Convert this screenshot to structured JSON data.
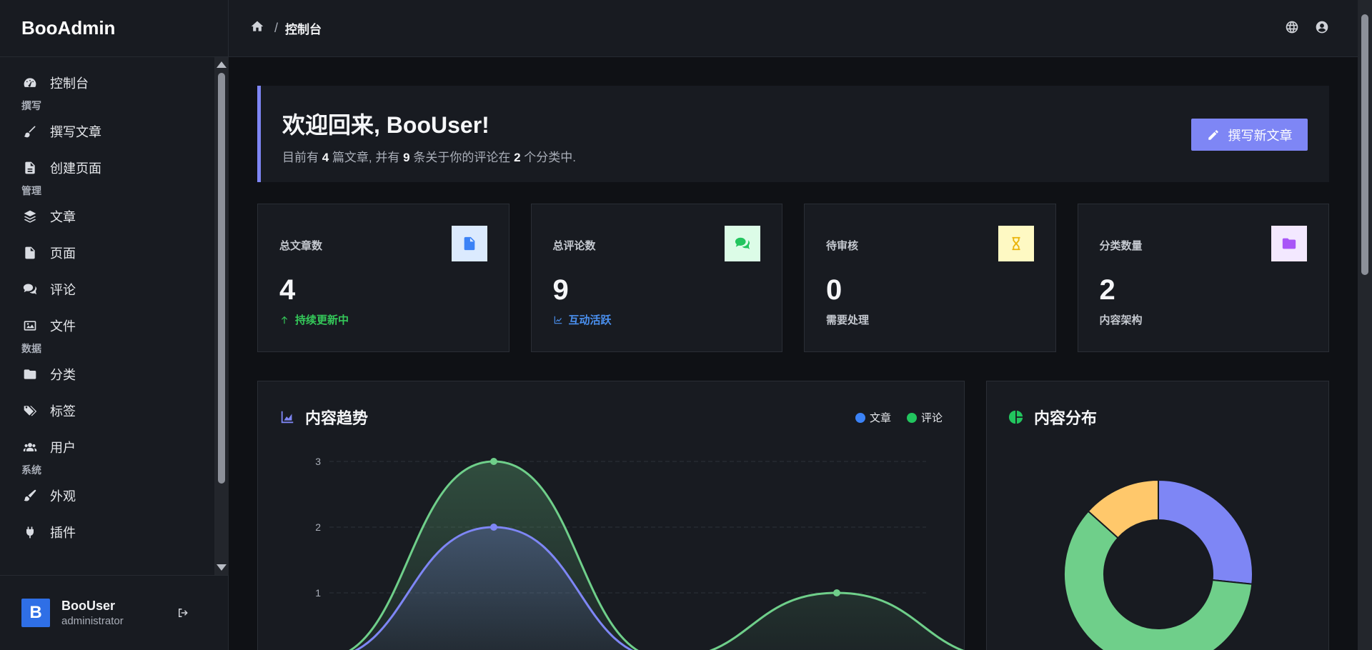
{
  "brand": "BooAdmin",
  "sidebar": {
    "items": [
      {
        "type": "item",
        "label": "控制台",
        "icon": "gauge-icon"
      },
      {
        "type": "group",
        "label": "撰写"
      },
      {
        "type": "item",
        "label": "撰写文章",
        "icon": "brush-icon"
      },
      {
        "type": "item",
        "label": "创建页面",
        "icon": "file-text-icon"
      },
      {
        "type": "group",
        "label": "管理"
      },
      {
        "type": "item",
        "label": "文章",
        "icon": "layers-icon"
      },
      {
        "type": "item",
        "label": "页面",
        "icon": "file-icon"
      },
      {
        "type": "item",
        "label": "评论",
        "icon": "comments-icon"
      },
      {
        "type": "item",
        "label": "文件",
        "icon": "images-icon"
      },
      {
        "type": "group",
        "label": "数据"
      },
      {
        "type": "item",
        "label": "分类",
        "icon": "folder-icon"
      },
      {
        "type": "item",
        "label": "标签",
        "icon": "tags-icon"
      },
      {
        "type": "item",
        "label": "用户",
        "icon": "users-icon"
      },
      {
        "type": "group",
        "label": "系统"
      },
      {
        "type": "item",
        "label": "外观",
        "icon": "paint-brush-icon"
      },
      {
        "type": "item",
        "label": "插件",
        "icon": "plug-icon"
      }
    ]
  },
  "user": {
    "initial": "B",
    "name": "BooUser",
    "role": "administrator"
  },
  "breadcrumb": {
    "current": "控制台"
  },
  "welcome": {
    "title": "欢迎回来, BooUser!",
    "sub_prefix": "目前有",
    "posts": "4",
    "sub_mid1": "篇文章, 并有",
    "comments": "9",
    "sub_mid2": "条关于你的评论在",
    "categories": "2",
    "sub_suffix": "个分类中.",
    "button_label": "撰写新文章"
  },
  "stats": [
    {
      "label": "总文章数",
      "value": "4",
      "note": "持续更新中",
      "note_color": "#34c759",
      "icon": "file-icon",
      "icon_bg": "#dbeafe",
      "icon_color": "#3b82f6"
    },
    {
      "label": "总评论数",
      "value": "9",
      "note": "互动活跃",
      "note_color": "#4a90f0",
      "icon": "comments-icon",
      "icon_bg": "#dcfce7",
      "icon_color": "#22c55e"
    },
    {
      "label": "待审核",
      "value": "0",
      "note": "需要处理",
      "note_color": "#c4c8cf",
      "icon": "hourglass-icon",
      "icon_bg": "#fef9c3",
      "icon_color": "#eab308"
    },
    {
      "label": "分类数量",
      "value": "2",
      "note": "内容架构",
      "note_color": "#c4c8cf",
      "icon": "folder-icon",
      "icon_bg": "#f3e8ff",
      "icon_color": "#a855f7"
    }
  ],
  "trend_card": {
    "title": "内容趋势"
  },
  "dist_card": {
    "title": "内容分布"
  },
  "chart_data": [
    {
      "type": "area",
      "title": "内容趋势",
      "x": [
        0,
        1,
        2,
        3,
        4,
        5
      ],
      "ylim": [
        0,
        3
      ],
      "yticks": [
        "1",
        "2",
        "3"
      ],
      "grid": true,
      "legend": "top-right",
      "series": [
        {
          "name": "文章",
          "values": [
            0,
            2,
            0,
            0,
            0,
            0
          ],
          "color": "#7e86f5"
        },
        {
          "name": "评论",
          "values": [
            0,
            3,
            0,
            1,
            0,
            0
          ],
          "color": "#6fcf8a"
        }
      ]
    },
    {
      "type": "pie",
      "title": "内容分布",
      "slices": [
        {
          "value": 4,
          "color": "#7e86f5"
        },
        {
          "value": 9,
          "color": "#6fcf8a"
        },
        {
          "value": 2,
          "color": "#ffc86b"
        }
      ]
    }
  ]
}
